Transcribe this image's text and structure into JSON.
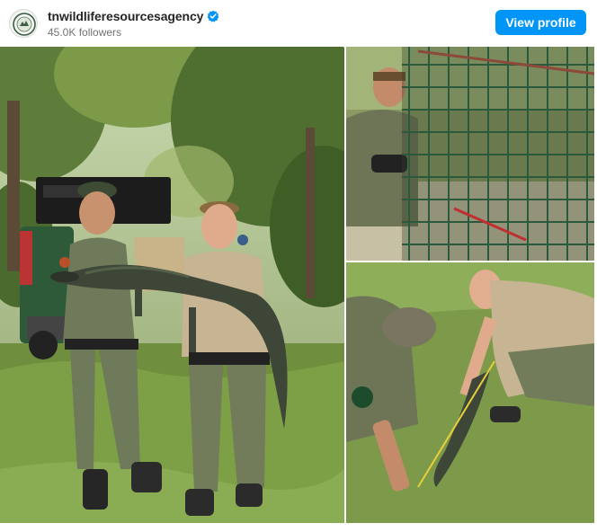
{
  "header": {
    "username": "tnwildliferesourcesagency",
    "followers": "45.0K followers",
    "view_profile_label": "View profile",
    "verified_color": "#0095f6",
    "button_color": "#0095f6"
  },
  "media": {
    "panels": [
      {
        "name": "group-photo",
        "icons": [
          "person",
          "alligator",
          "pickup-truck",
          "trees"
        ]
      },
      {
        "name": "trap-cage-photo",
        "icons": [
          "person",
          "cage"
        ]
      },
      {
        "name": "measuring-photo",
        "icons": [
          "person",
          "alligator",
          "measuring-tape"
        ]
      }
    ]
  }
}
